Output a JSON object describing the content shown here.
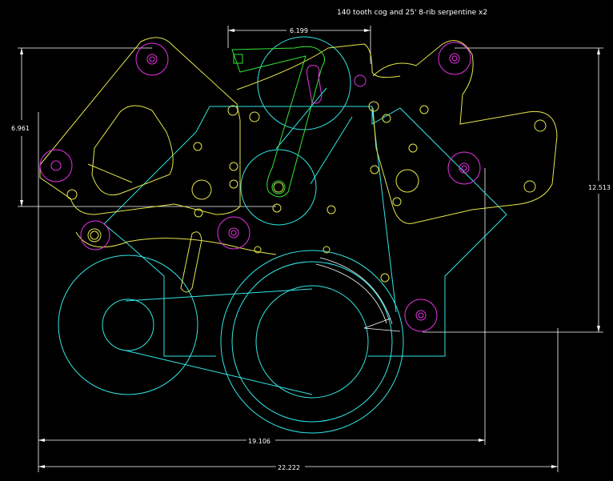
{
  "note": "140 tooth cog and 25' 8-rib serpentine x2",
  "dimensions": {
    "top": "6.199",
    "left": "6.961",
    "right": "12.513",
    "bottom_inner": "19.106",
    "bottom_outer": "22.222"
  },
  "colors": {
    "background": "#000000",
    "cyan": "#33e6e6",
    "yellow": "#e6e64d",
    "magenta": "#e633e6",
    "green": "#33e633",
    "white": "#ffffff"
  }
}
